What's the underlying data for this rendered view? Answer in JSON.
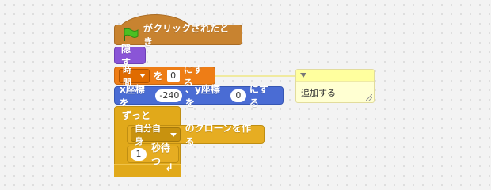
{
  "hat_block": {
    "label": "がクリックされたとき",
    "icon": "green-flag-icon",
    "color": "#c88330"
  },
  "hide_block": {
    "label": "隠す",
    "color": "#8a55d7"
  },
  "set_var_block": {
    "variable": "時間",
    "to_label": "を",
    "value": "0",
    "suffix": "にする",
    "color": "#ee7d16"
  },
  "comment": {
    "text": "追加する"
  },
  "goto_block": {
    "x_label": "x座標を",
    "x_value": "-240",
    "sep_label": "、y座標を",
    "y_value": "0",
    "suffix": "にする",
    "color": "#4a6cd4"
  },
  "forever_block": {
    "label": "ずっと",
    "color": "#e1a91a"
  },
  "clone_block": {
    "target": "自分自身",
    "suffix": "のクローンを作る"
  },
  "wait_block": {
    "value": "1",
    "suffix": "秒待つ"
  }
}
